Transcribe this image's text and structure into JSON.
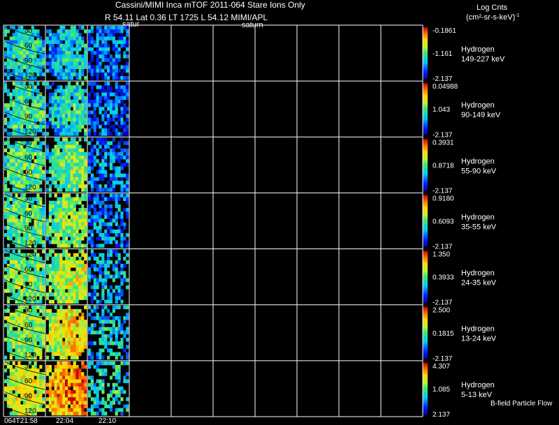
{
  "header": {
    "title_line1": "Cassini/MIMI Inca mTOF  2011-064   Stare   Ions Only",
    "title_line2": "R        54.11 Lat 0.36 LT 1725 L          54.12  MIMI/APL",
    "saturn_label_a": "satur",
    "saturn_label_b": "saturn",
    "units_title": "Log Cnts",
    "units_sub": "(cm²-sr-s-keV)",
    "units_exp": "-1",
    "footer_note": "B-field Particle Flow"
  },
  "time_axis": {
    "labels": [
      "064T21:58",
      "22:04",
      "22:10"
    ],
    "filled_columns": 3,
    "total_columns": 10
  },
  "colors": {
    "background": "#000000",
    "grid": "#ffffff"
  },
  "chart_data": {
    "type": "heatmap",
    "colormap": "rainbow (blue-cyan-green-yellow-red)",
    "grid": true,
    "rows": [
      {
        "species": "Hydrogen",
        "energy": "149-227 keV",
        "cbar_max": "-0.1861",
        "cbar_mid": "-1.161",
        "cbar_min": "-2.137",
        "contours": [
          "30",
          "60",
          "90",
          "120"
        ],
        "panel_levels": [
          0.45,
          0.4,
          0.28
        ]
      },
      {
        "species": "Hydrogen",
        "energy": "90-149 keV",
        "cbar_max": "0.04988",
        "cbar_mid": "1.043",
        "cbar_min": "-2.137",
        "contours": [
          "30",
          "60",
          "90",
          "120"
        ],
        "panel_levels": [
          0.5,
          0.45,
          0.25
        ]
      },
      {
        "species": "Hydrogen",
        "energy": "55-90 keV",
        "cbar_max": "0.3931",
        "cbar_mid": "0.8718",
        "cbar_min": "-2.137",
        "contours": [
          "30",
          "60",
          "90",
          "120"
        ],
        "panel_levels": [
          0.52,
          0.55,
          0.3
        ]
      },
      {
        "species": "Hydrogen",
        "energy": "35-55 keV",
        "cbar_max": "0.9180",
        "cbar_mid": "0.6093",
        "cbar_min": "-2.137",
        "contours": [
          "30",
          "60",
          "90",
          "120"
        ],
        "panel_levels": [
          0.55,
          0.6,
          0.3
        ]
      },
      {
        "species": "Hydrogen",
        "energy": "24-35 keV",
        "cbar_max": "1.350",
        "cbar_mid": "0.3933",
        "cbar_min": "-2.137",
        "contours": [
          "120",
          "60",
          "90",
          "120"
        ],
        "panel_levels": [
          0.58,
          0.66,
          0.35
        ]
      },
      {
        "species": "Hydrogen",
        "energy": "13-24 keV",
        "cbar_max": "2.500",
        "cbar_mid": "0.1815",
        "cbar_min": "-2.137",
        "contours": [
          "30",
          "60",
          "90",
          "120"
        ],
        "panel_levels": [
          0.62,
          0.75,
          0.4
        ]
      },
      {
        "species": "Hydrogen",
        "energy": "5-13 keV",
        "cbar_max": "4.307",
        "cbar_mid": "1.085",
        "cbar_min": "2.137",
        "contours": [
          "30",
          "60",
          "90",
          "120"
        ],
        "panel_levels": [
          0.7,
          0.88,
          0.45
        ]
      }
    ]
  }
}
